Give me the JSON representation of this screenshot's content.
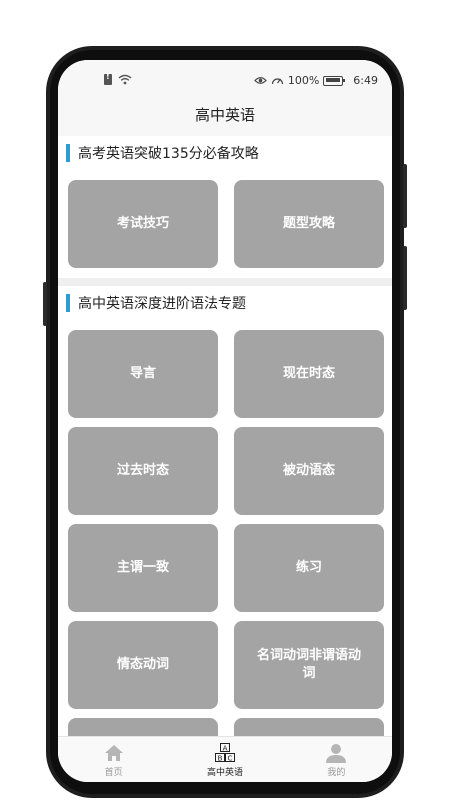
{
  "status_bar": {
    "battery": "100%",
    "time": "6:49"
  },
  "header": {
    "title": "高中英语"
  },
  "sections": [
    {
      "title": "高考英语突破135分必备攻略",
      "items": [
        "考试技巧",
        "题型攻略"
      ]
    },
    {
      "title": "高中英语深度进阶语法专题",
      "items": [
        "导言",
        "现在时态",
        "过去时态",
        "被动语态",
        "主谓一致",
        "练习",
        "情态动词",
        "名词动词非谓语动词"
      ]
    }
  ],
  "bottom_nav": {
    "items": [
      {
        "label": "首页",
        "icon": "home-icon",
        "active": false
      },
      {
        "label": "高中英语",
        "icon": "abc-blocks-icon",
        "active": true
      },
      {
        "label": "我的",
        "icon": "user-icon",
        "active": false
      }
    ]
  },
  "colors": {
    "accent": "#2e9bd6",
    "tile": "#a4a4a4",
    "frame": "#1e1e1e"
  }
}
